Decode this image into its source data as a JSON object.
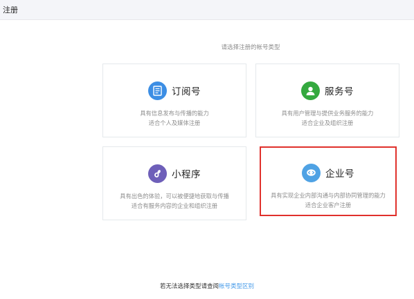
{
  "header": {
    "title": "注册"
  },
  "prompt": "请选择注册的帐号类型",
  "cards": [
    {
      "title": "订阅号",
      "icon": "document-icon",
      "icon_color": "#3c8ee4",
      "desc_line1": "具有信息发布与传播的能力",
      "desc_line2": "适合个人及媒体注册",
      "selected": false
    },
    {
      "title": "服务号",
      "icon": "person-icon",
      "icon_color": "#34a93f",
      "desc_line1": "具有用户管理与提供业务服务的能力",
      "desc_line2": "适合企业及组织注册",
      "selected": false
    },
    {
      "title": "小程序",
      "icon": "miniprogram-icon",
      "icon_color": "#6e5fb9",
      "desc_line1": "具有出色的体验，可以被便捷地获取与传播",
      "desc_line2": "适合有服务内容的企业和组织注册",
      "selected": false
    },
    {
      "title": "企业号",
      "icon": "chat-bubble-icon",
      "icon_color": "#4fa2e4",
      "desc_line1": "具有实现企业内部沟通与内部协同管理的能力",
      "desc_line2": "适合企业客户注册",
      "selected": true
    }
  ],
  "footer": {
    "text": "若无法选择类型请查阅",
    "link_label": "帐号类型区别"
  }
}
